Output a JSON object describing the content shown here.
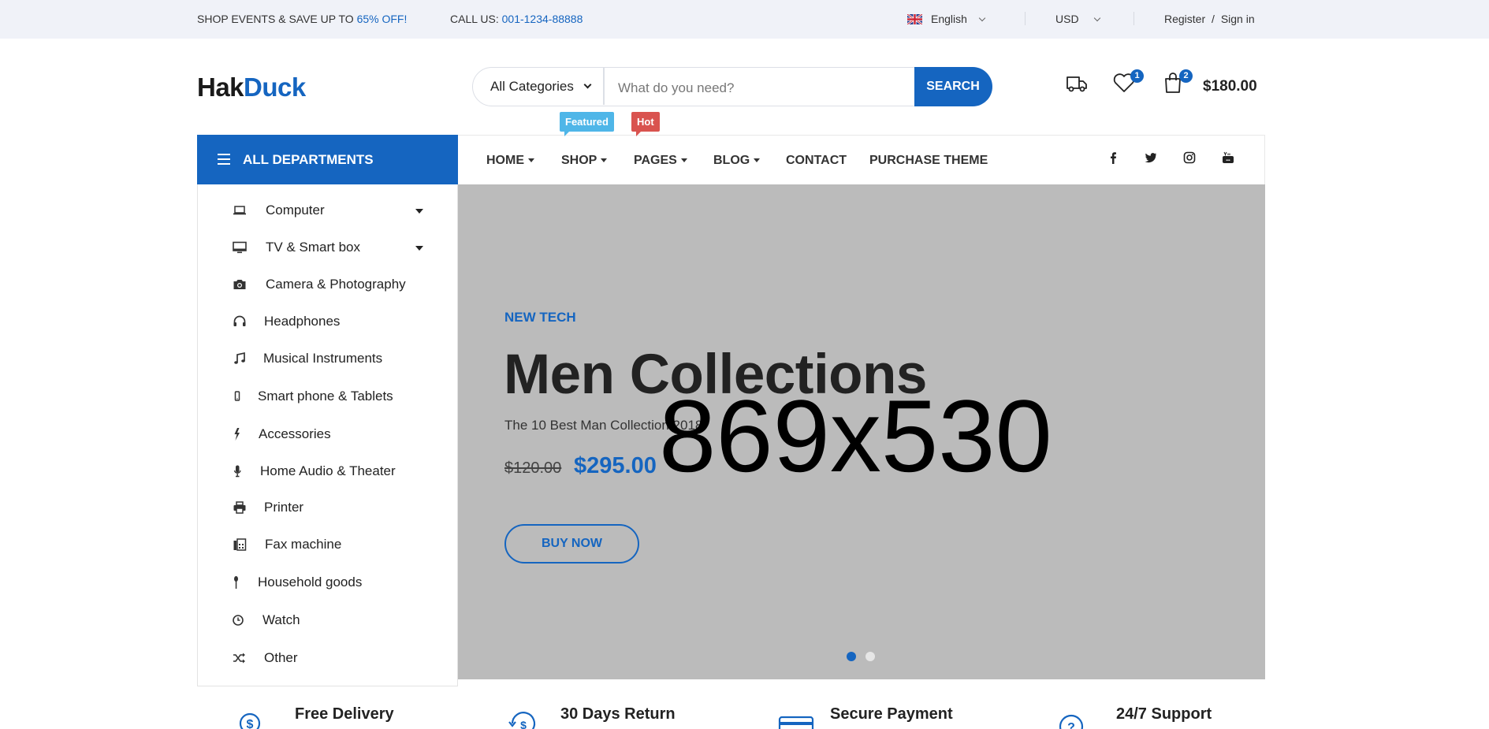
{
  "colors": {
    "accent": "#1565c0",
    "topbar_bg": "#f0f2f8",
    "hero_bg": "#bbbbbb",
    "featured_tag": "#4fb6e8",
    "hot_tag": "#d9534f"
  },
  "topbar": {
    "promo_prefix": "SHOP EVENTS & SAVE UP TO ",
    "promo_highlight": "65% OFF!",
    "call_prefix": "CALL US: ",
    "call_number": "001-1234-88888",
    "language": "English",
    "language_icon": "uk-flag-icon",
    "currency": "USD",
    "register": "Register",
    "separator": "/",
    "signin": "Sign in"
  },
  "logo": {
    "part1": "Hak",
    "part2": "Duck"
  },
  "search": {
    "category": "All Categories",
    "placeholder": "What do you need?",
    "button": "SEARCH"
  },
  "header_icons": {
    "compare_icon": "truck-icon",
    "wishlist_icon": "heart-icon",
    "wishlist_count": "1",
    "cart_icon": "shopping-bag-icon",
    "cart_count": "2",
    "cart_total": "$180.00"
  },
  "departments": {
    "title": "ALL DEPARTMENTS",
    "items": [
      {
        "label": "Computer",
        "icon": "laptop-icon",
        "has_submenu": true
      },
      {
        "label": "TV & Smart box",
        "icon": "monitor-icon",
        "has_submenu": true
      },
      {
        "label": "Camera & Photography",
        "icon": "camera-icon",
        "has_submenu": false
      },
      {
        "label": "Headphones",
        "icon": "headphones-icon",
        "has_submenu": false
      },
      {
        "label": "Musical Instruments",
        "icon": "music-icon",
        "has_submenu": false
      },
      {
        "label": "Smart phone & Tablets",
        "icon": "mobile-icon",
        "has_submenu": false
      },
      {
        "label": "Accessories",
        "icon": "bolt-icon",
        "has_submenu": false
      },
      {
        "label": "Home Audio & Theater",
        "icon": "microphone-icon",
        "has_submenu": false
      },
      {
        "label": "Printer",
        "icon": "printer-icon",
        "has_submenu": false
      },
      {
        "label": "Fax machine",
        "icon": "fax-icon",
        "has_submenu": false
      },
      {
        "label": "Household goods",
        "icon": "brush-icon",
        "has_submenu": false
      },
      {
        "label": "Watch",
        "icon": "clock-icon",
        "has_submenu": false
      },
      {
        "label": "Other",
        "icon": "shuffle-icon",
        "has_submenu": false
      }
    ]
  },
  "nav": {
    "items": [
      {
        "label": "HOME",
        "dropdown": true
      },
      {
        "label": "SHOP",
        "dropdown": true,
        "tag": "Featured"
      },
      {
        "label": "PAGES",
        "dropdown": true,
        "tag": "Hot"
      },
      {
        "label": "BLOG",
        "dropdown": true
      },
      {
        "label": "CONTACT",
        "dropdown": false
      },
      {
        "label": "PURCHASE THEME",
        "dropdown": false
      }
    ],
    "social": [
      "facebook-icon",
      "twitter-icon",
      "instagram-icon",
      "youtube-icon"
    ]
  },
  "hero": {
    "kicker": "NEW TECH",
    "title": "Men Collections",
    "subtitle": "The 10 Best Man Collection 2018",
    "old_price": "$120.00",
    "new_price": "$295.00",
    "placeholder_text": "869x530",
    "button": "BUY NOW",
    "slides": 2,
    "active_slide": 1
  },
  "features": [
    {
      "title": "Free Delivery",
      "icon": "dollar-circle-icon"
    },
    {
      "title": "30 Days Return",
      "icon": "return-icon"
    },
    {
      "title": "Secure Payment",
      "icon": "credit-card-icon"
    },
    {
      "title": "24/7 Support",
      "icon": "question-icon"
    }
  ]
}
